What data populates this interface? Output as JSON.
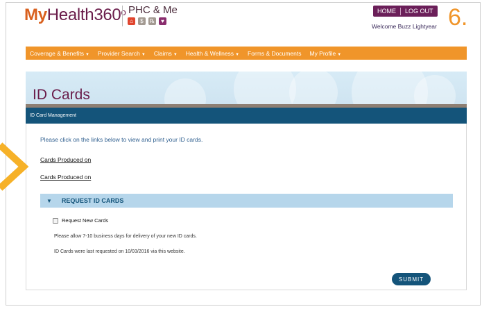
{
  "brand": {
    "logo_my": "My",
    "logo_rest": "Health360",
    "logo_degree": "o",
    "product": "PHC & Me"
  },
  "phc_icons": [
    {
      "name": "house-icon",
      "color": "#e0452e"
    },
    {
      "name": "dollar-icon",
      "color": "#a39a92"
    },
    {
      "name": "rx-icon",
      "color": "#a39a92"
    },
    {
      "name": "heart-icon",
      "color": "#8a2d6e"
    }
  ],
  "top_nav": {
    "home": "HOME",
    "logout": "LOG OUT"
  },
  "welcome": "Welcome Buzz Lightyear",
  "step_number": "6.",
  "main_nav": [
    {
      "label": "Coverage & Benefits",
      "has_caret": true
    },
    {
      "label": "Provider Search",
      "has_caret": true
    },
    {
      "label": "Claims",
      "has_caret": true
    },
    {
      "label": "Health & Wellness",
      "has_caret": true
    },
    {
      "label": "Forms & Documents",
      "has_caret": false
    },
    {
      "label": "My Profile",
      "has_caret": true
    }
  ],
  "page": {
    "title": "ID Cards",
    "subnav": "ID Card Management",
    "instructions": "Please click on the links below to view and print your ID cards.",
    "links": [
      "Cards Produced on",
      "Cards Produced on"
    ]
  },
  "request": {
    "header": "REQUEST ID CARDS",
    "checkbox_label": "Request New Cards",
    "note1": "Please allow 7-10 business days for delivery of your new ID cards.",
    "note2": "ID Cards were last requested on 10/03/2016 via this website.",
    "submit": "SUBMIT"
  },
  "colors": {
    "orange": "#f0952a",
    "plum": "#6b1f59",
    "navy": "#14547a",
    "light_blue": "#b6d6eb",
    "arrow": "#f6b128"
  }
}
